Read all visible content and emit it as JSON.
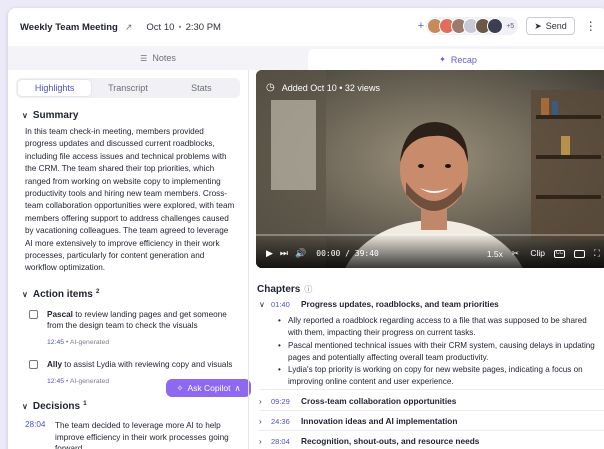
{
  "header": {
    "title": "Weekly Team Meeting",
    "date": "Oct 10",
    "time": "2:30 PM",
    "more_participants": "+5",
    "send_label": "Send",
    "plus": "+"
  },
  "view_tabs": [
    {
      "label": "Notes",
      "active": false
    },
    {
      "label": "Recap",
      "active": true
    }
  ],
  "sub_tabs": [
    {
      "label": "Highlights",
      "active": true
    },
    {
      "label": "Transcript",
      "active": false
    },
    {
      "label": "Stats",
      "active": false
    }
  ],
  "summary": {
    "heading": "Summary",
    "text": "In this team check-in meeting, members provided progress updates and discussed current roadblocks, including file access issues and technical problems with the CRM. The team shared their top priorities, which ranged from working on website copy to implementing productivity tools and hiring new team members. Cross-team collaboration opportunities were explored, with team members offering support to address challenges caused by vacationing colleagues. The team agreed to leverage AI more extensively to improve efficiency in their work processes, particularly for content generation and workflow optimization."
  },
  "action_items": {
    "heading": "Action items",
    "count": "2",
    "items": [
      {
        "assignee": "Pascal",
        "text": " to review landing pages and get someone from the design team to check the visuals",
        "time": "12:45",
        "tag": "AI-generated"
      },
      {
        "assignee": "Ally",
        "text": " to assist Lydia with reviewing copy and visuals",
        "time": "12:45",
        "tag": "AI-generated"
      }
    ]
  },
  "decisions": {
    "heading": "Decisions",
    "count": "1",
    "items": [
      {
        "time": "28:04",
        "text": "The team decided to leverage more AI to help improve efficiency in their work processes going forward."
      }
    ]
  },
  "copilot_label": "Ask Copilot",
  "video": {
    "meta": "Added Oct 10 • 32 views",
    "time": "00:00 / 39:40",
    "speed": "1.5x",
    "clip_label": "Clip",
    "progress": 0
  },
  "chapters": {
    "heading": "Chapters",
    "items": [
      {
        "time": "01:40",
        "title": "Progress updates, roadblocks, and team priorities",
        "expanded": true,
        "bullets": [
          "Ally reported a roadblock regarding access to a file that was supposed to be shared with them, impacting their progress on current tasks.",
          "Pascal mentioned technical issues with their CRM system, causing delays in updating pages and potentially affecting overall team productivity.",
          "Lydia's top priority is working on copy for new website pages, indicating a focus on improving online content and user experience."
        ]
      },
      {
        "time": "09:29",
        "title": "Cross-team collaboration opportunities",
        "expanded": false
      },
      {
        "time": "24:36",
        "title": "Innovation ideas and AI implementation",
        "expanded": false
      },
      {
        "time": "28:04",
        "title": "Recognition, shout-outs, and resource needs",
        "expanded": false
      }
    ]
  },
  "colors": {
    "accent": "#5b5fd8",
    "copilot": "#8c69f0"
  }
}
